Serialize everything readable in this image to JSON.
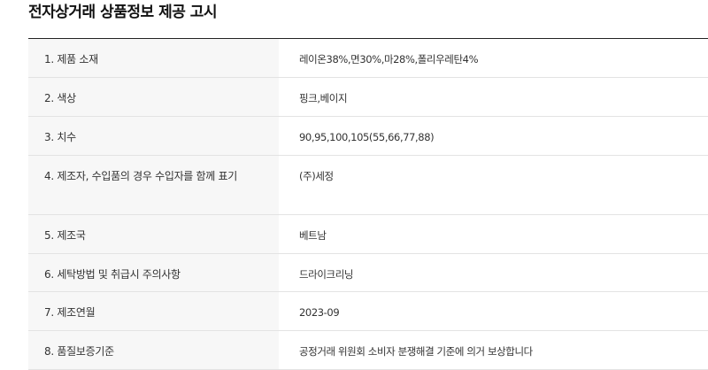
{
  "title": "전자상거래 상품정보 제공 고시",
  "rows": [
    {
      "label": "1. 제품 소재",
      "value": "레이온38%,면30%,마28%,폴리우레탄4%"
    },
    {
      "label": "2. 색상",
      "value": "핑크,베이지"
    },
    {
      "label": "3. 치수",
      "value": "90,95,100,105(55,66,77,88)"
    },
    {
      "label": "4. 제조자, 수입품의 경우 수입자를 함께 표기",
      "value": "(주)세정"
    },
    {
      "label": "5. 제조국",
      "value": "베트남"
    },
    {
      "label": "6. 세탁방법 및 취급시 주의사항",
      "value": "드라이크리닝"
    },
    {
      "label": "7. 제조연월",
      "value": "2023-09"
    },
    {
      "label": "8. 품질보증기준",
      "value": "공정거래 위원회 소비자 분쟁해결 기준에 의거 보상합니다"
    }
  ]
}
